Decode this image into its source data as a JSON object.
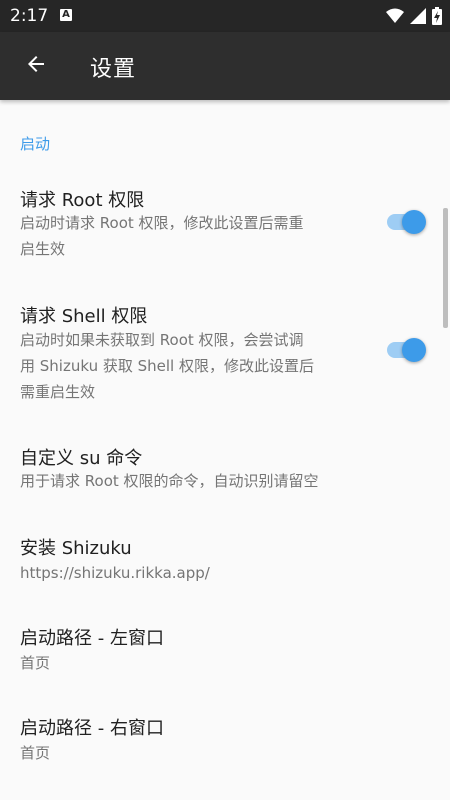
{
  "status_bar": {
    "time": "2:17",
    "notification_icon": "A"
  },
  "app_bar": {
    "title": "设置"
  },
  "section": {
    "header": "启动"
  },
  "prefs": [
    {
      "title": "请求 Root 权限",
      "summary_lines": [
        "启动时请求 Root 权限，修改此设置后需重",
        "启生效"
      ],
      "switch_on": true
    },
    {
      "title": "请求 Shell 权限",
      "summary_lines": [
        "启动时如果未获取到 Root 权限，会尝试调",
        "用 Shizuku 获取 Shell 权限，修改此设置后",
        "需重启生效"
      ],
      "switch_on": true
    },
    {
      "title": "自定义 su 命令",
      "summary_lines": [
        "用于请求 Root 权限的命令，自动识别请留空"
      ]
    },
    {
      "title": "安装 Shizuku",
      "summary_lines": [
        "https://shizuku.rikka.app/"
      ]
    },
    {
      "title": "启动路径 - 左窗口",
      "summary_lines": [
        "首页"
      ]
    },
    {
      "title": "启动路径 - 右窗口",
      "summary_lines": [
        "首页"
      ]
    }
  ],
  "colors": {
    "accent": "#3d9be9",
    "app_bar": "#2e2e2e",
    "status_bar": "#262626",
    "background": "#fafafa"
  }
}
